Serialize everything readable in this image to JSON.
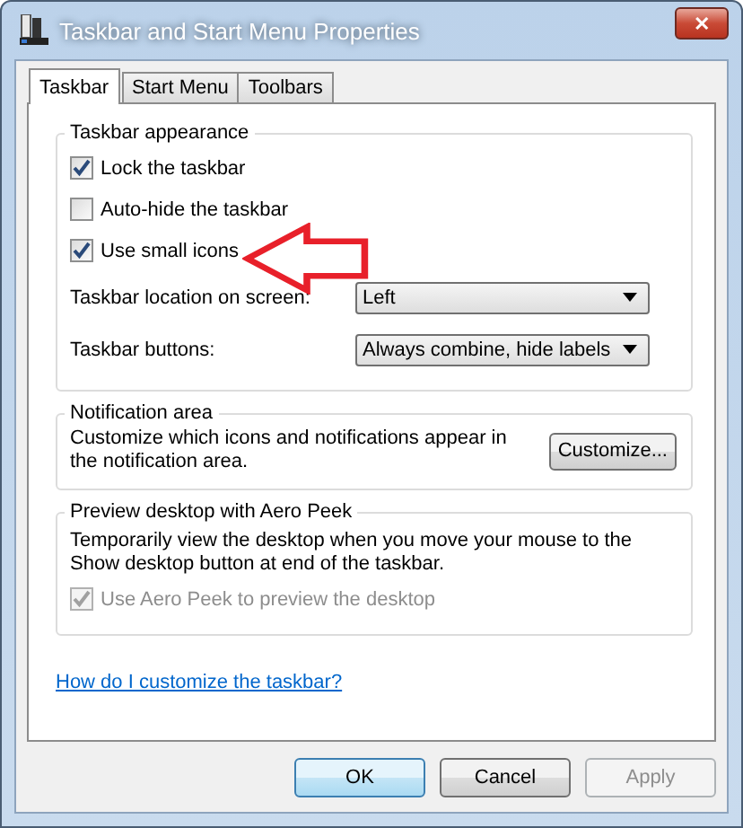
{
  "window": {
    "title": "Taskbar and Start Menu Properties",
    "close_label": "✕"
  },
  "tabs": [
    {
      "label": "Taskbar",
      "selected": true
    },
    {
      "label": "Start Menu",
      "selected": false
    },
    {
      "label": "Toolbars",
      "selected": false
    }
  ],
  "appearance": {
    "title": "Taskbar appearance",
    "checkboxes": [
      {
        "label": "Lock the taskbar",
        "checked": true,
        "disabled": false
      },
      {
        "label": "Auto-hide the taskbar",
        "checked": false,
        "disabled": false
      },
      {
        "label": "Use small icons",
        "checked": true,
        "disabled": false
      }
    ],
    "dropdowns": [
      {
        "label": "Taskbar location on screen:",
        "value": "Left"
      },
      {
        "label": "Taskbar buttons:",
        "value": "Always combine, hide labels"
      }
    ]
  },
  "notification": {
    "title": "Notification area",
    "text": "Customize which icons and notifications appear in the notification area.",
    "button": "Customize..."
  },
  "aero_peek": {
    "title": "Preview desktop with Aero Peek",
    "text": "Temporarily view the desktop when you move your mouse to the Show desktop button at end of the taskbar.",
    "checkboxes": [
      {
        "label": "Use Aero Peek to preview the desktop",
        "checked": true,
        "disabled": true
      }
    ]
  },
  "help_link": "How do I customize the taskbar?",
  "buttons": [
    {
      "label": "OK",
      "kind": "default",
      "disabled": false
    },
    {
      "label": "Cancel",
      "kind": "normal",
      "disabled": false
    },
    {
      "label": "Apply",
      "kind": "normal",
      "disabled": true
    }
  ]
}
